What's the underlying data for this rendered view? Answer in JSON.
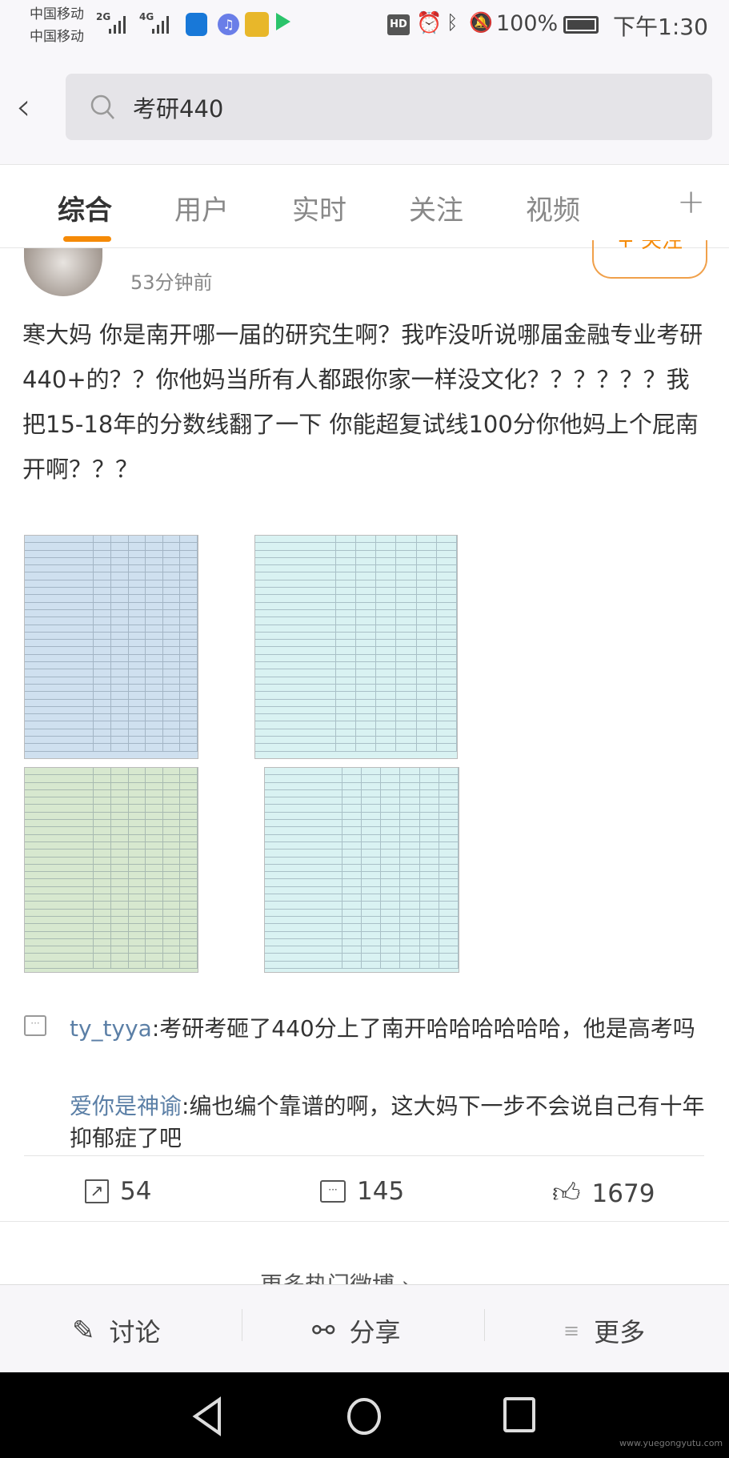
{
  "status_bar": {
    "carrier1": "中国移动",
    "carrier2": "中国移动",
    "net1": "2G",
    "net2": "4G",
    "battery": "100%",
    "time": "下午1:30",
    "hd": "HD"
  },
  "search": {
    "query": "考研440"
  },
  "tabs": [
    {
      "label": "综合",
      "active": true
    },
    {
      "label": "用户"
    },
    {
      "label": "实时"
    },
    {
      "label": "关注"
    },
    {
      "label": "视频"
    }
  ],
  "tabs_more": "+",
  "post": {
    "time": "53分钟前",
    "follow_label": "+ 关注",
    "text": "寒大妈 你是南开哪一届的研究生啊？我咋没听说哪届金融专业考研440+的？？你他妈当所有人都跟你家一样没文化？？？？？？我把15-18年的分数线翻了一下 你能超复试线100分你他妈上个屁南开啊？？？",
    "images": [
      {
        "color": "#cfe0ef"
      },
      {
        "color": "#d9f2f2"
      },
      {
        "color": "#d7e8cf"
      },
      {
        "color": "#d9f2f2"
      }
    ],
    "comments": [
      {
        "user": "ty_tyya",
        "text": ":考研考砸了440分上了南开哈哈哈哈哈哈，他是高考吗"
      },
      {
        "user": "爱你是神谕",
        "text": ":编也编个靠谱的啊，这大妈下一步不会说自己有十年抑郁症了吧"
      }
    ],
    "reposts": "54",
    "comments_count": "145",
    "likes": "1679"
  },
  "more_hot": "更多热门微博",
  "bottom_bar": {
    "discuss": "讨论",
    "share": "分享",
    "more": "更多"
  },
  "watermark": "www.yuegongyutu.com",
  "colors": {
    "accent": "#f58a07",
    "username": "#5b7fa6"
  }
}
